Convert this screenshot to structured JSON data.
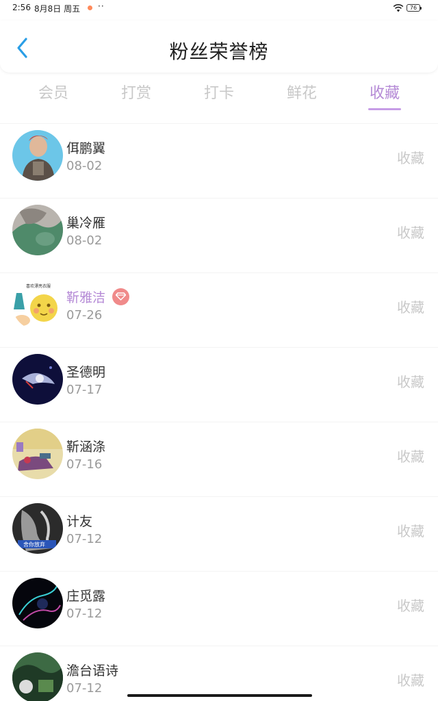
{
  "status_bar": {
    "time": "2:56",
    "date": "8月8日 周五",
    "dots": "··",
    "battery": "76"
  },
  "header": {
    "title": "粉丝荣誉榜"
  },
  "tabs": [
    {
      "label": "会员"
    },
    {
      "label": "打赏"
    },
    {
      "label": "打卡"
    },
    {
      "label": "鲜花"
    },
    {
      "label": "收藏"
    }
  ],
  "active_tab": "收藏",
  "colors": {
    "accent": "#b58ad6",
    "inactive_tab": "#c8c8c8",
    "vip_badge": "#f08a8a"
  },
  "list": [
    {
      "name": "佴鹏翼",
      "date": "08-02",
      "action": "收藏"
    },
    {
      "name": "巢冷雁",
      "date": "08-02",
      "action": "收藏"
    },
    {
      "name": "靳雅洁",
      "date": "07-26",
      "action": "收藏",
      "vip": true
    },
    {
      "name": "圣德明",
      "date": "07-17",
      "action": "收藏"
    },
    {
      "name": "靳涵涤",
      "date": "07-16",
      "action": "收藏"
    },
    {
      "name": "计友",
      "date": "07-12",
      "action": "收藏"
    },
    {
      "name": "庄觅露",
      "date": "07-12",
      "action": "收藏"
    },
    {
      "name": "澹台语诗",
      "date": "07-12",
      "action": "收藏"
    }
  ],
  "avatar_text": {
    "item2": "喜欢漂亮衣服",
    "item5": "舍你放弃"
  }
}
